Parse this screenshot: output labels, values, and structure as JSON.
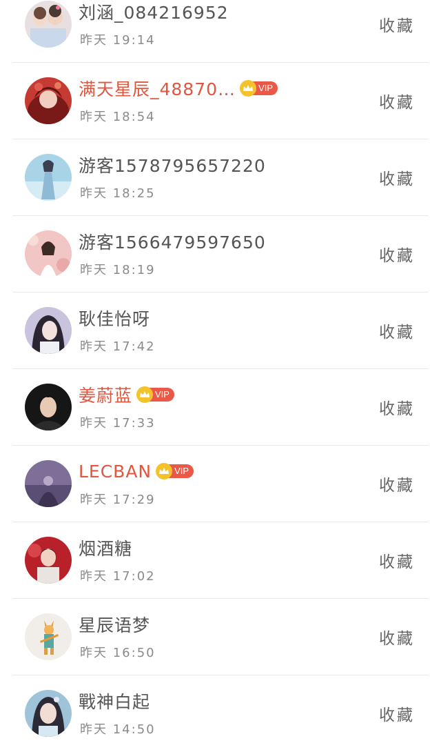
{
  "collect_label": "收藏",
  "vip_label": "VIP",
  "users": [
    {
      "name": "刘涵_084216952",
      "time": "昨天 19:14",
      "vip": false
    },
    {
      "name": "满天星辰_48870…",
      "time": "昨天 18:54",
      "vip": true
    },
    {
      "name": "游客1578795657220",
      "time": "昨天 18:25",
      "vip": false
    },
    {
      "name": "游客1566479597650",
      "time": "昨天 18:19",
      "vip": false
    },
    {
      "name": "耿佳怡呀",
      "time": "昨天 17:42",
      "vip": false
    },
    {
      "name": "姜蔚蓝",
      "time": "昨天 17:33",
      "vip": true
    },
    {
      "name": "LECBAN",
      "time": "昨天 17:29",
      "vip": true
    },
    {
      "name": "烟酒糖",
      "time": "昨天 17:02",
      "vip": false
    },
    {
      "name": "星辰语梦",
      "time": "昨天 16:50",
      "vip": false
    },
    {
      "name": "戰神白起",
      "time": "昨天 14:50",
      "vip": false
    }
  ],
  "colors": {
    "vip_name": "#e2553e",
    "vip_tag": "#ea5947",
    "crown": "#f4c22b",
    "name": "#555555",
    "time": "#8a8a8a"
  }
}
